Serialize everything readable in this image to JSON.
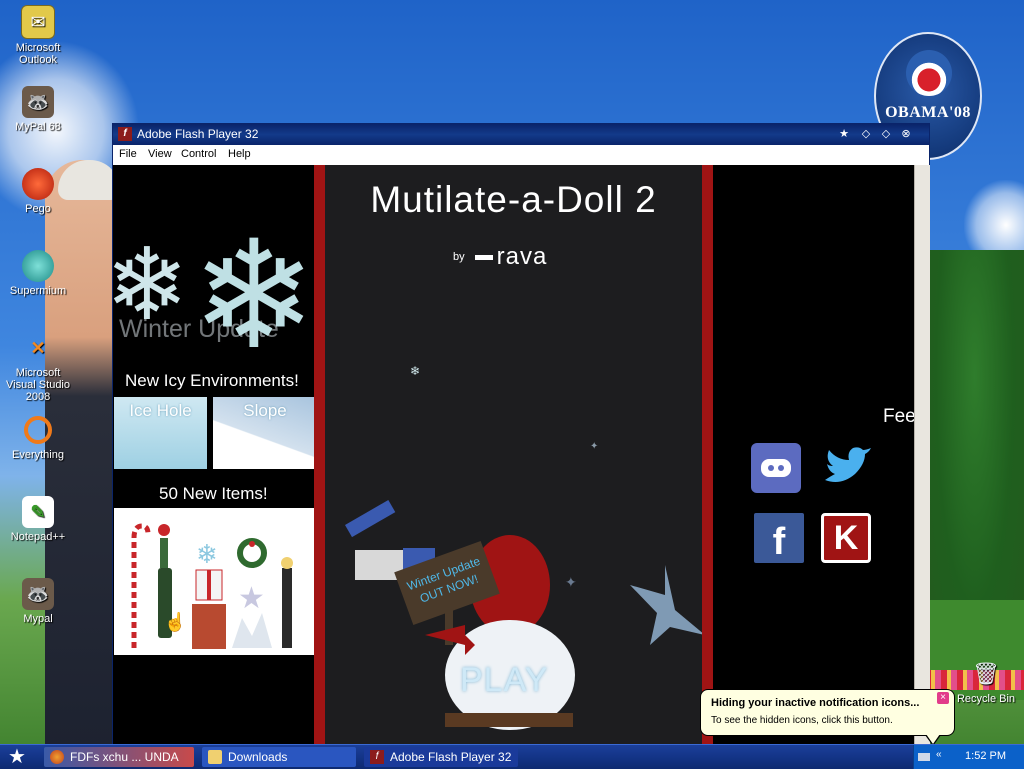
{
  "desktop": {
    "icons": [
      {
        "label": "Microsoft Outlook",
        "icon": "outlook-icon"
      },
      {
        "label": "MyPal 68",
        "icon": "raccoon-icon"
      },
      {
        "label": "Pego",
        "icon": "pego-icon"
      },
      {
        "label": "Supermium",
        "icon": "supermium-icon"
      },
      {
        "label": "Microsoft Visual Studio 2008",
        "icon": "visual-studio-icon"
      },
      {
        "label": "Everything",
        "icon": "everything-icon"
      },
      {
        "label": "Notepad++",
        "icon": "notepadpp-icon"
      },
      {
        "label": "Mypal",
        "icon": "raccoon-icon"
      },
      {
        "label": "Recycle Bin",
        "icon": "recycle-bin-icon"
      }
    ],
    "badge_text": "OBAMA'08"
  },
  "window": {
    "title": "Adobe Flash Player 32",
    "menu": [
      "File",
      "View",
      "Control",
      "Help"
    ]
  },
  "game": {
    "title": "Mutilate-a-Doll 2",
    "by_label": "by",
    "author": "rava",
    "winter_update": "Winter Update",
    "new_environments": "New Icy Environments!",
    "environments": [
      "Ice Hole",
      "Slope"
    ],
    "new_items": "50 New Items!",
    "sign_text_1": "Winter Update",
    "sign_text_2": "OUT NOW!",
    "play_label": "PLAY",
    "feedback_title": "Feedback?",
    "social": [
      "discord-icon",
      "twitter-icon",
      "facebook-icon",
      "kongregate-icon"
    ]
  },
  "taskbar": {
    "tasks": [
      {
        "label": "FDFs  xchu ... UNDA",
        "icon": "firefox-icon"
      },
      {
        "label": "Downloads",
        "icon": "folder-icon"
      },
      {
        "label": "Adobe Flash Player 32",
        "icon": "flash-icon"
      }
    ],
    "clock": "1:52 PM"
  },
  "notification": {
    "title": "Hiding your inactive notification icons...",
    "text": "To see the hidden icons, click this button."
  },
  "colors": {
    "accent_red": "#a01414",
    "titlebar": "#0a246a",
    "taskbar": "#123283",
    "balloon": "#ffffe1"
  }
}
